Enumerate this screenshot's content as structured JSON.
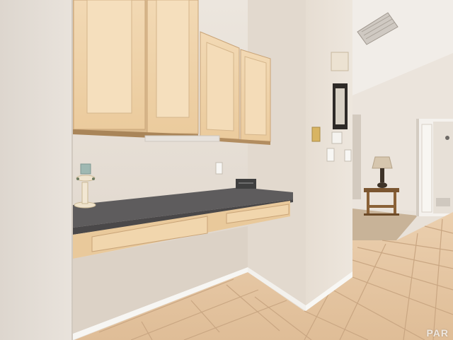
{
  "photo": {
    "watermark": "PAR",
    "colors": {
      "wall": "#e9e2d9",
      "wall_shadow": "#d9cfc4",
      "ceiling": "#f2eee9",
      "cabinet": "#efd2a8",
      "cabinet_edge": "#c9a478",
      "countertop": "#5d5b5c",
      "floor_tile": "#e6c6a2",
      "grout": "#c9a784",
      "baseboard": "#f7f6f3",
      "carpet": "#c9b49a"
    }
  }
}
